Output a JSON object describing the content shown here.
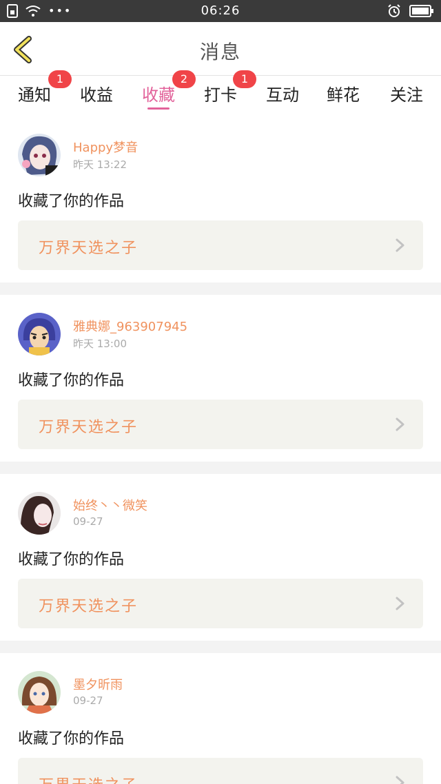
{
  "status_bar": {
    "time": "06:26"
  },
  "header": {
    "title": "消息"
  },
  "tabs": [
    {
      "label": "通知",
      "badge": "1",
      "active": false
    },
    {
      "label": "收益",
      "badge": "",
      "active": false
    },
    {
      "label": "收藏",
      "badge": "2",
      "active": true
    },
    {
      "label": "打卡",
      "badge": "1",
      "active": false
    },
    {
      "label": "互动",
      "badge": "",
      "active": false
    },
    {
      "label": "鲜花",
      "badge": "",
      "active": false
    },
    {
      "label": "关注",
      "badge": "",
      "active": false
    }
  ],
  "messages": [
    {
      "user": "Happy梦音",
      "time": "昨天 13:22",
      "action": "收藏了你的作品",
      "work_title": "万界天选之子"
    },
    {
      "user": "雅典娜_963907945",
      "time": "昨天 13:00",
      "action": "收藏了你的作品",
      "work_title": "万界天选之子"
    },
    {
      "user": "始终丶丶微笑",
      "time": "09-27",
      "action": "收藏了你的作品",
      "work_title": "万界天选之子"
    },
    {
      "user": "墨夕昕雨",
      "time": "09-27",
      "action": "收藏了你的作品",
      "work_title": "万界天选之子"
    }
  ],
  "colors": {
    "accent": "#e2629a",
    "username": "#f0925e",
    "badge": "#f04448"
  }
}
